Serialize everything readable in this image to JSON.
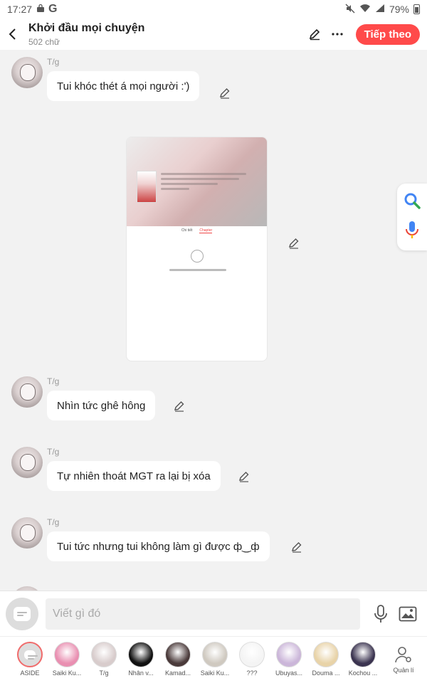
{
  "status_bar": {
    "time": "17:27",
    "battery": "79%"
  },
  "header": {
    "title": "Khởi đầu mọi chuyện",
    "subtitle": "502 chữ",
    "next_label": "Tiếp theo"
  },
  "messages": [
    {
      "sender": "T/g",
      "text": "Tui khóc thét á mọi người :')"
    },
    {
      "sender": "T/g",
      "text": "Nhìn tức ghê hông"
    },
    {
      "sender": "T/g",
      "text": "Tự nhiên thoát MGT ra lại bị xóa"
    },
    {
      "sender": "T/g",
      "text": "Tui tức nhưng tui không làm gì được ф‿ф"
    }
  ],
  "image_card": {
    "tab_left": "Chi tiết",
    "tab_right": "Chapter"
  },
  "input": {
    "placeholder": "Viết gì đó"
  },
  "characters": [
    {
      "name": "ASIDE",
      "color": "#dddddd"
    },
    {
      "name": "Saiki Ku...",
      "color": "#e98fb1"
    },
    {
      "name": "T/g",
      "color": "#d8cccc"
    },
    {
      "name": "Nhân v...",
      "color": "#111111"
    },
    {
      "name": "Kamad...",
      "color": "#4a3a3a"
    },
    {
      "name": "Saiki Ku...",
      "color": "#cfc9c0"
    },
    {
      "name": "???",
      "color": "#f4f4f4"
    },
    {
      "name": "Ubuyas...",
      "color": "#cbb6d9"
    },
    {
      "name": "Douma ...",
      "color": "#e8d3a8"
    },
    {
      "name": "Kochou ...",
      "color": "#3b3450"
    }
  ],
  "manage_label": "Quản lí",
  "colors": {
    "accent": "#ff4a4a",
    "background": "#f2f2f2"
  }
}
